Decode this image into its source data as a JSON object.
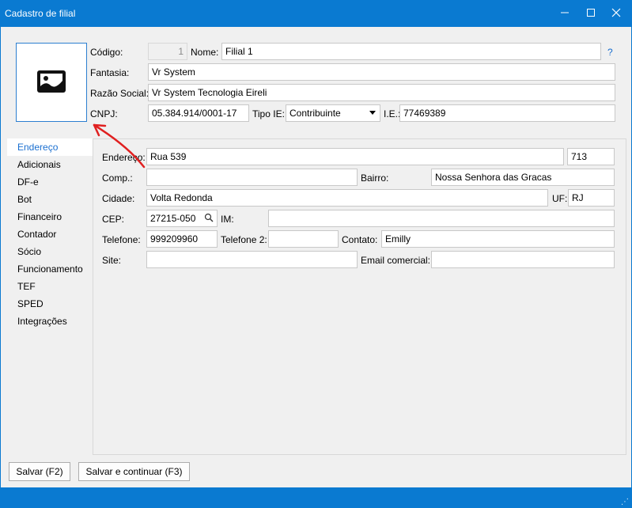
{
  "window": {
    "title": "Cadastro de filial"
  },
  "header": {
    "codigo_label": "Código:",
    "codigo_value": "1",
    "nome_label": "Nome:",
    "nome_value": "Filial 1",
    "help": "?",
    "fantasia_label": "Fantasia:",
    "fantasia_value": "Vr System",
    "razao_label": "Razão Social:",
    "razao_value": "Vr System Tecnologia Eireli",
    "cnpj_label": "CNPJ:",
    "cnpj_value": "05.384.914/0001-17",
    "tipo_ie_label": "Tipo IE:",
    "tipo_ie_value": "Contribuinte",
    "ie_label": "I.E.:",
    "ie_value": "77469389"
  },
  "nav": {
    "items": [
      "Endereço",
      "Adicionais",
      "DF-e",
      "Bot",
      "Financeiro",
      "Contador",
      "Sócio",
      "Funcionamento",
      "TEF",
      "SPED",
      "Integrações"
    ],
    "active_index": 0
  },
  "address": {
    "endereco_label": "Endereço:",
    "endereco_value": "Rua 539",
    "numero_value": "713",
    "comp_label": "Comp.:",
    "comp_value": "",
    "bairro_label": "Bairro:",
    "bairro_value": "Nossa Senhora das Gracas",
    "cidade_label": "Cidade:",
    "cidade_value": "Volta Redonda",
    "uf_label": "UF:",
    "uf_value": "RJ",
    "cep_label": "CEP:",
    "cep_value": "27215-050",
    "im_label": "IM:",
    "im_value": "",
    "telefone_label": "Telefone:",
    "telefone_value": "999209960",
    "telefone2_label": "Telefone 2:",
    "telefone2_value": "",
    "contato_label": "Contato:",
    "contato_value": "Emilly",
    "site_label": "Site:",
    "site_value": "",
    "email_label": "Email comercial:",
    "email_value": ""
  },
  "footer": {
    "save_label": "Salvar (F2)",
    "save_continue_label": "Salvar e continuar (F3)"
  },
  "colors": {
    "titlebar": "#0a7ad1",
    "accent": "#1a6fd0",
    "annotation_arrow": "#e02020"
  },
  "icons": [
    "image-placeholder-icon",
    "minimize-icon",
    "maximize-icon",
    "close-icon",
    "search-icon",
    "chevron-down-icon",
    "resize-grip-icon"
  ]
}
